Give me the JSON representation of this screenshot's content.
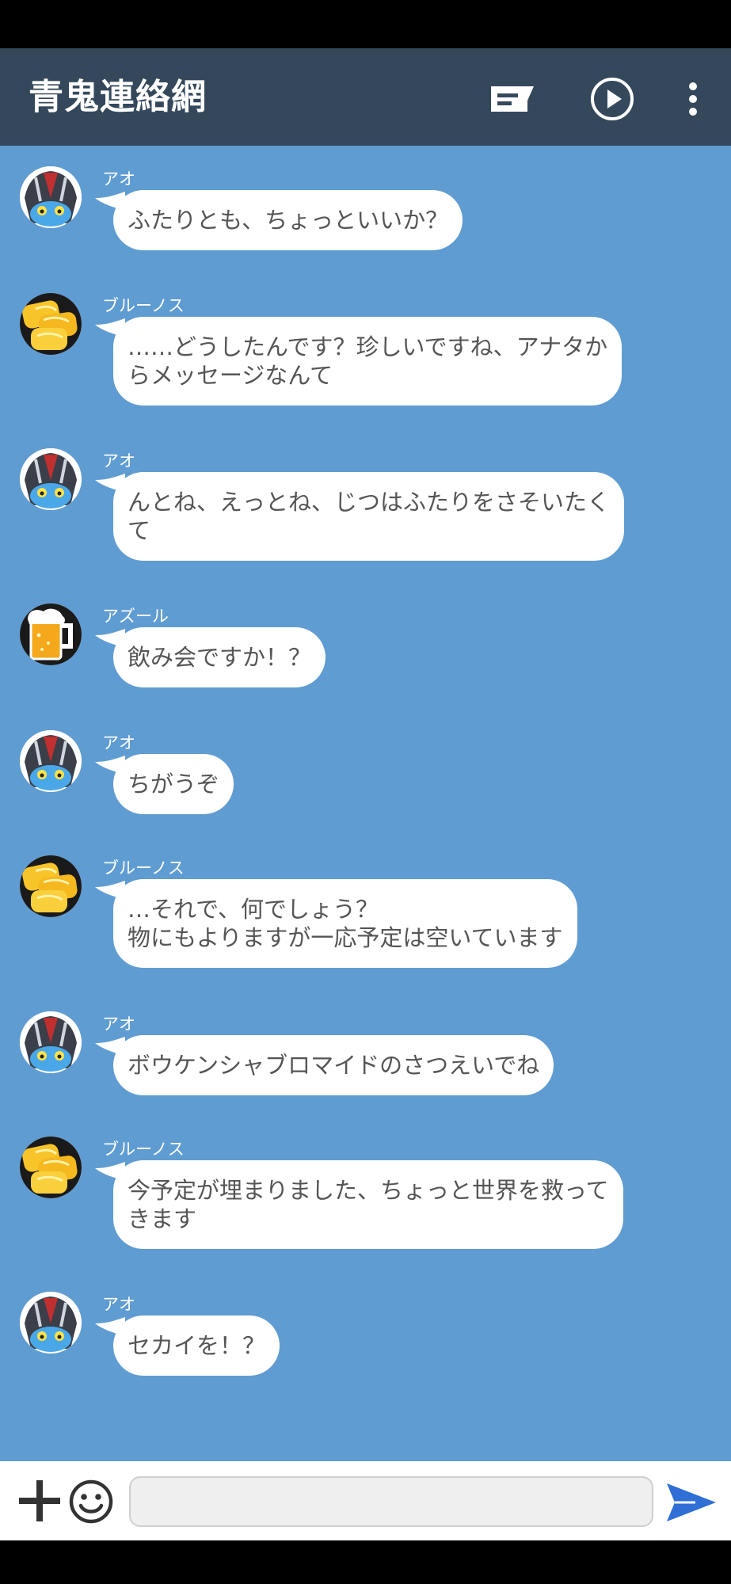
{
  "header": {
    "title": "青鬼連絡網",
    "icons": [
      "message-icon",
      "play-icon",
      "more-vert-icon"
    ]
  },
  "chat": {
    "messages": [
      {
        "sender": "アオ",
        "avatar": "blue-demon",
        "lines": [
          "ふたりとも、ちょっといいか？"
        ]
      },
      {
        "sender": "ブルーノス",
        "avatar": "tamagoyaki",
        "lines": [
          "……どうしたんです？珍しいですね、アナタか",
          "らメッセージなんて"
        ]
      },
      {
        "sender": "アオ",
        "avatar": "blue-demon",
        "lines": [
          "んとね、えっとね、じつはふたりをさそいたく",
          "て"
        ]
      },
      {
        "sender": "アズール",
        "avatar": "beer-mug",
        "lines": [
          "飲み会ですか！？"
        ]
      },
      {
        "sender": "アオ",
        "avatar": "blue-demon",
        "lines": [
          "ちがうぞ"
        ]
      },
      {
        "sender": "ブルーノス",
        "avatar": "tamagoyaki",
        "lines": [
          "…それで、何でしょう？",
          "物にもよりますが一応予定は空いています"
        ]
      },
      {
        "sender": "アオ",
        "avatar": "blue-demon",
        "lines": [
          "ボウケンシャブロマイドのさつえいでね"
        ]
      },
      {
        "sender": "ブルーノス",
        "avatar": "tamagoyaki",
        "lines": [
          "今予定が埋まりました、ちょっと世界を救って",
          "きます"
        ]
      },
      {
        "sender": "アオ",
        "avatar": "blue-demon",
        "lines": [
          "セカイを！？"
        ]
      }
    ]
  },
  "composer": {
    "input_value": "",
    "icons": [
      "plus-icon",
      "emoji-icon",
      "send-icon"
    ]
  },
  "colors": {
    "header_bg": "#35485b",
    "chat_bg": "#5f9cd2",
    "bubble_bg": "#ffffff",
    "bubble_text": "#555555",
    "send_accent": "#2f6fd6"
  }
}
